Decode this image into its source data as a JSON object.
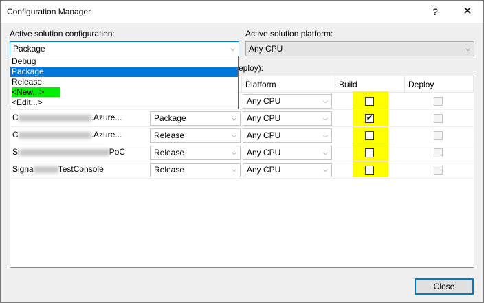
{
  "window": {
    "title": "Configuration Manager",
    "help_glyph": "?",
    "close_glyph": "✕"
  },
  "active_config": {
    "label": "Active solution configuration:",
    "value": "Package",
    "options": [
      "Debug",
      "Package",
      "Release",
      "<New...>",
      "<Edit...>"
    ]
  },
  "active_platform": {
    "label": "Active solution platform:",
    "value": "Any CPU"
  },
  "contexts_label_partial": "eploy):",
  "grid": {
    "headers": {
      "platform": "Platform",
      "build": "Build",
      "deploy": "Deploy"
    },
    "rows": [
      {
        "name": "",
        "config": "",
        "platform": "Any CPU",
        "build": false,
        "deploy": false
      },
      {
        "name_start": "C",
        "name_end": ".Azure...",
        "config": "Package",
        "platform": "Any CPU",
        "build": true,
        "deploy": false
      },
      {
        "name_start": "C",
        "name_end": ".Azure...",
        "config": "Release",
        "platform": "Any CPU",
        "build": false,
        "deploy": false
      },
      {
        "name_start": "Si",
        "name_end": "PoC",
        "config": "Release",
        "platform": "Any CPU",
        "build": false,
        "deploy": false
      },
      {
        "name_start": "Signa",
        "name_end": "TestConsole",
        "config": "Release",
        "platform": "Any CPU",
        "build": false,
        "deploy": false
      }
    ]
  },
  "buttons": {
    "close": "Close"
  },
  "colors": {
    "accent": "#0078d7",
    "highlight_yellow": "#ffff00",
    "highlight_green": "#00ee00"
  },
  "icons": {
    "dropdown": "chevron-down-icon",
    "check": "checkmark-icon"
  }
}
